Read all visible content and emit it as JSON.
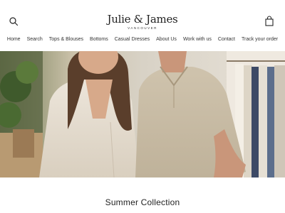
{
  "brand": {
    "name": "Julie & James",
    "tagline": "VANCOUVER"
  },
  "nav": {
    "items": [
      {
        "label": "Home"
      },
      {
        "label": "Search"
      },
      {
        "label": "Tops & Blouses"
      },
      {
        "label": "Bottoms"
      },
      {
        "label": "Casual Dresses"
      },
      {
        "label": "About Us"
      },
      {
        "label": "Work with us"
      },
      {
        "label": "Contact"
      },
      {
        "label": "Track your order"
      }
    ]
  },
  "icons": {
    "search": "search-icon",
    "cart": "shopping-bag-icon"
  },
  "hero": {
    "section_title": "Summer Collection"
  }
}
